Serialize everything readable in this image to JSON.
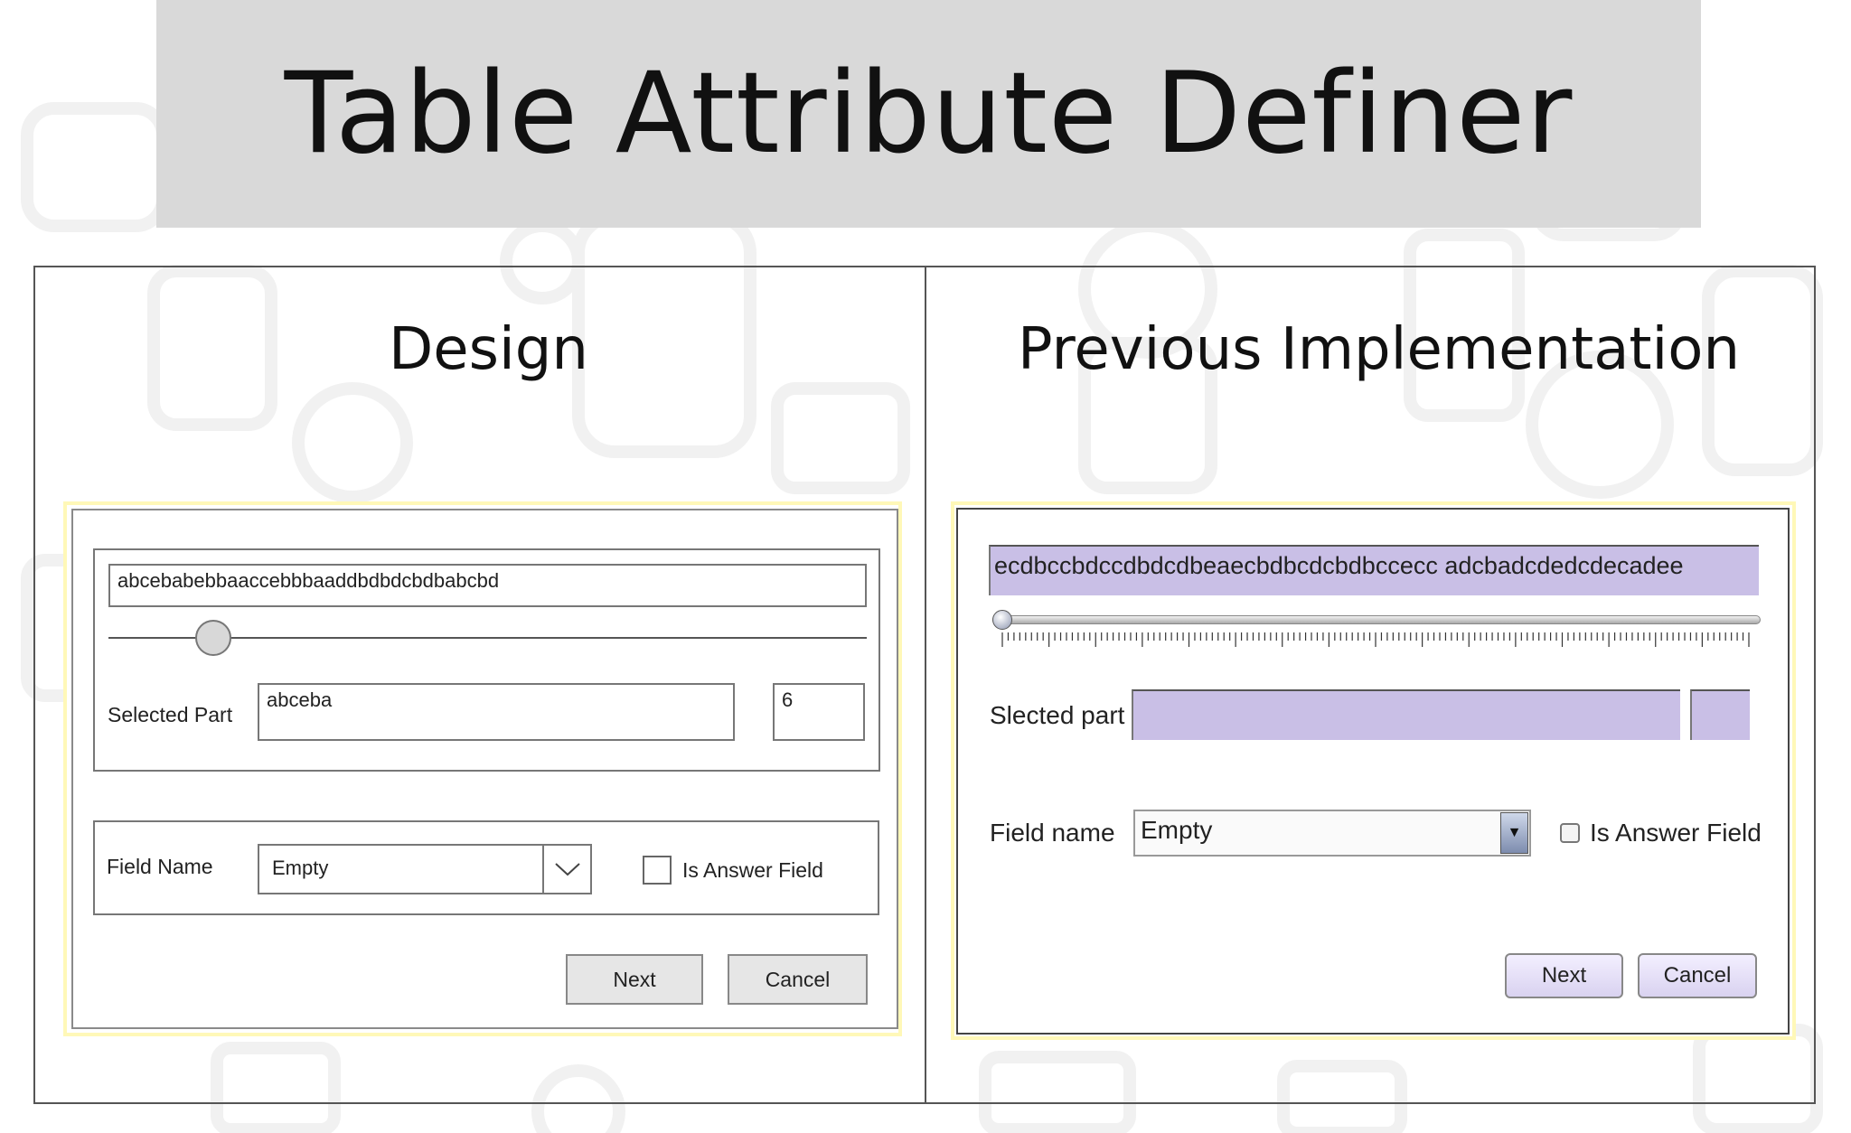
{
  "title": "Table Attribute Definer",
  "design": {
    "heading": "Design",
    "text_field_value": "abcebabebbaaccebbbaaddbdbdcbdbabcbd",
    "slider_position": 0.12,
    "selected_part_label": "Selected Part",
    "selected_part_value": "abceba",
    "selected_part_length": "6",
    "field_name_label": "Field Name",
    "field_name_value": "Empty",
    "is_answer_label": "Is Answer Field",
    "is_answer_checked": false,
    "next_label": "Next",
    "cancel_label": "Cancel"
  },
  "implementation": {
    "heading": "Previous Implementation",
    "text_field_value": "ecdbccbdccdbdcdbeaecbdbcdcbdbccecc adcbadcdedcdecadee",
    "slider_position": 0.0,
    "selected_part_label": "Slected part",
    "selected_part_value": "",
    "selected_part_length": "",
    "field_name_label": "Field name",
    "field_name_value": "Empty",
    "combo_arrow": "▼",
    "is_answer_label": "Is Answer  Field",
    "is_answer_checked": false,
    "next_label": "Next",
    "cancel_label": "Cancel"
  },
  "colors": {
    "title_background": "#d9d9d9",
    "highlight_border": "#fff8b8",
    "impl_field_fill": "#c9bfe6"
  },
  "icons": {
    "combo_chevron": "chevron-down-icon",
    "combo_arrow": "triangle-down-icon"
  }
}
